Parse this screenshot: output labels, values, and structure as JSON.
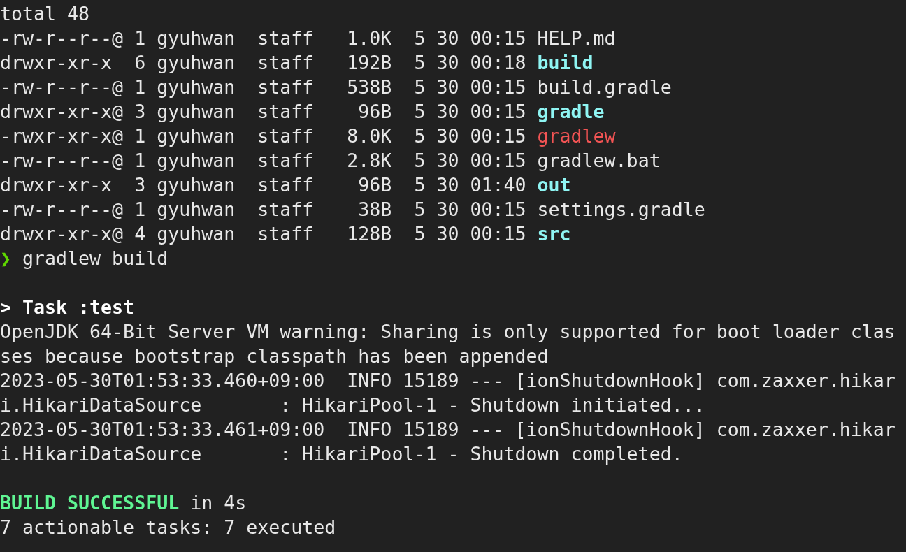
{
  "terminal": {
    "lines": [
      {
        "kind": "text",
        "text": "total 48"
      },
      {
        "kind": "listing",
        "meta": "-rw-r--r--@ 1 gyuhwan  staff   1.0K  5 30 00:15",
        "name": "HELP.md",
        "directory": false,
        "executable": false
      },
      {
        "kind": "listing",
        "meta": "drwxr-xr-x  6 gyuhwan  staff   192B  5 30 00:18",
        "name": "build",
        "directory": true,
        "executable": false
      },
      {
        "kind": "listing",
        "meta": "-rw-r--r--@ 1 gyuhwan  staff   538B  5 30 00:15",
        "name": "build.gradle",
        "directory": false,
        "executable": false
      },
      {
        "kind": "listing",
        "meta": "drwxr-xr-x@ 3 gyuhwan  staff    96B  5 30 00:15",
        "name": "gradle",
        "directory": true,
        "executable": false
      },
      {
        "kind": "listing",
        "meta": "-rwxr-xr-x@ 1 gyuhwan  staff   8.0K  5 30 00:15",
        "name": "gradlew",
        "directory": false,
        "executable": true
      },
      {
        "kind": "listing",
        "meta": "-rw-r--r--@ 1 gyuhwan  staff   2.8K  5 30 00:15",
        "name": "gradlew.bat",
        "directory": false,
        "executable": false
      },
      {
        "kind": "listing",
        "meta": "drwxr-xr-x  3 gyuhwan  staff    96B  5 30 01:40",
        "name": "out",
        "directory": true,
        "executable": false
      },
      {
        "kind": "listing",
        "meta": "-rw-r--r--@ 1 gyuhwan  staff    38B  5 30 00:15",
        "name": "settings.gradle",
        "directory": false,
        "executable": false
      },
      {
        "kind": "listing",
        "meta": "drwxr-xr-x@ 4 gyuhwan  staff   128B  5 30 00:15",
        "name": "src",
        "directory": true,
        "executable": false
      },
      {
        "kind": "prompt",
        "symbol": "❯",
        "command": "gradlew build"
      },
      {
        "kind": "blank"
      },
      {
        "kind": "heading",
        "text": "> Task :test"
      },
      {
        "kind": "text",
        "text": "OpenJDK 64-Bit Server VM warning: Sharing is only supported for boot loader clas"
      },
      {
        "kind": "text",
        "text": "ses because bootstrap classpath has been appended"
      },
      {
        "kind": "text",
        "text": "2023-05-30T01:53:33.460+09:00  INFO 15189 --- [ionShutdownHook] com.zaxxer.hikar"
      },
      {
        "kind": "text",
        "text": "i.HikariDataSource       : HikariPool-1 - Shutdown initiated..."
      },
      {
        "kind": "text",
        "text": "2023-05-30T01:53:33.461+09:00  INFO 15189 --- [ionShutdownHook] com.zaxxer.hikar"
      },
      {
        "kind": "text",
        "text": "i.HikariDataSource       : HikariPool-1 - Shutdown completed."
      },
      {
        "kind": "blank"
      },
      {
        "kind": "result",
        "status": "BUILD SUCCESSFUL",
        "text": "in 4s"
      },
      {
        "kind": "text",
        "text": "7 actionable tasks: 7 executed"
      }
    ]
  }
}
